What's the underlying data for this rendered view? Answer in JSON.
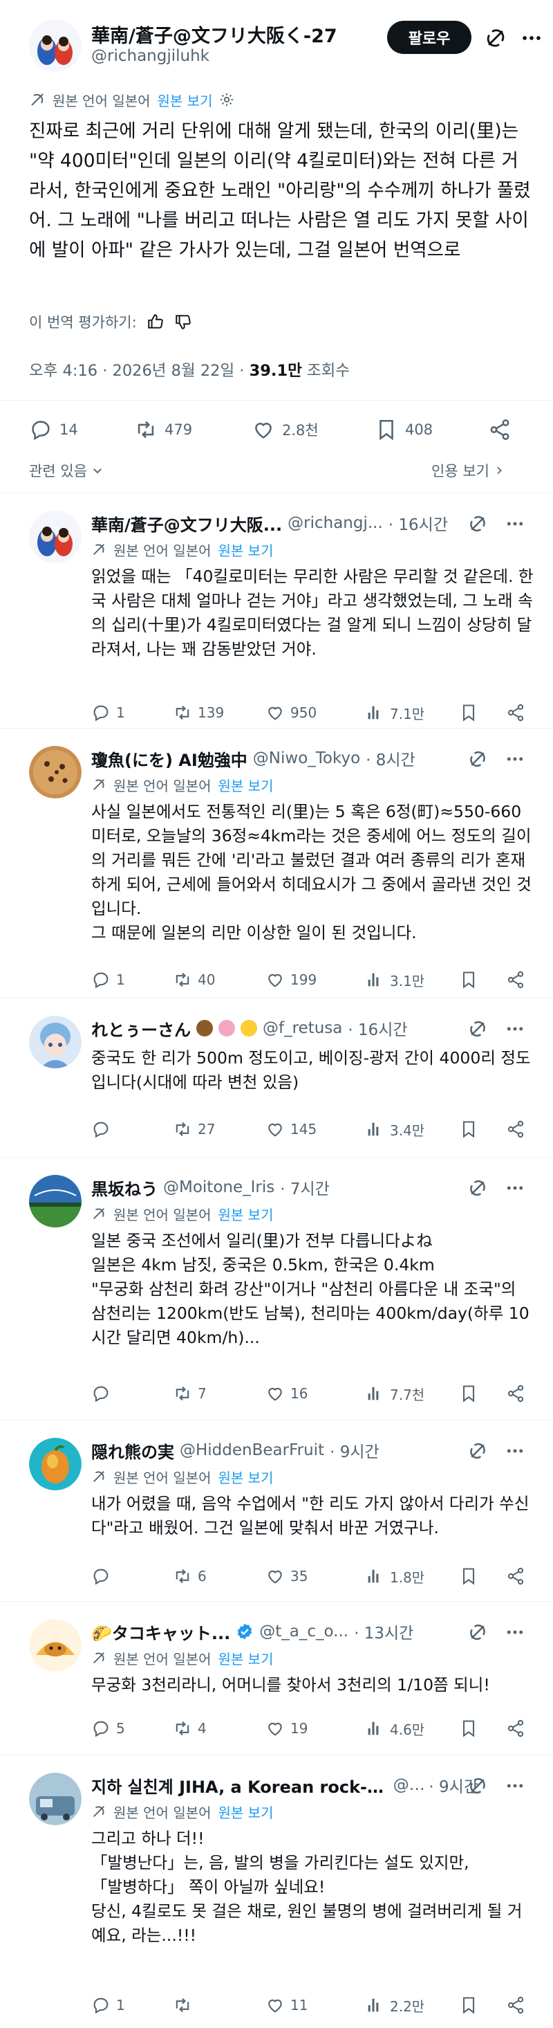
{
  "main_post": {
    "author_name": "華南/蒼子@文フリ大阪く-27",
    "author_handle": "@richangjiluhk",
    "follow_label": "팔로우",
    "translation_label": "원본 언어 일본어",
    "view_original_label": "원본 보기",
    "text": "진짜로 최근에 거리 단위에 대해 알게 됐는데, 한국의 이리(里)는 \"약 400미터\"인데 일본의 이리(약 4킬로미터)와는 전혀 다른 거라서, 한국인에게 중요한 노래인 \"아리랑\"의 수수께끼 하나가 풀렸어. 그 노래에 \"나를 버리고 떠나는 사람은 열 리도 가지 못할 사이에 발이 아파\" 같은 가사가 있는데, 그걸 일본어 번역으로",
    "rate_label": "이 번역 평가하기:",
    "time": "오후 4:16 · 2026년 8월 22일 · ",
    "views_count": "39.1만",
    "views_label": " 조회수",
    "replies_count": "14",
    "reposts_count": "479",
    "likes_count": "2.8천",
    "bookmarks_count": "408",
    "related_label": "관련 있음",
    "quotes_label": "인용 보기"
  },
  "replies": [
    {
      "name": "華南/蒼子@文フリ大阪...",
      "handle": "@richangj...",
      "time": "· 16시간",
      "translation_label": "원본 언어 일본어",
      "view_original_label": "원본 보기",
      "text": "읽었을 때는 「40킬로미터는 무리한 사람은 무리할 것 같은데. 한국 사람은 대체 얼마나 걷는 거야」라고 생각했었는데, 그 노래 속의 십리(十里)가 4킬로미터였다는 걸 알게 되니 느낌이 상당히 달라져서, 나는 꽤 감동받았던 거야.",
      "replies": "1",
      "reposts": "139",
      "likes": "950",
      "views": "7.1만"
    },
    {
      "name": "瓊魚(にを) AI勉強中",
      "handle": "@Niwo_Tokyo",
      "time": "· 8시간",
      "translation_label": "원본 언어 일본어",
      "view_original_label": "원본 보기",
      "text": "사실 일본에서도 전통적인 리(里)는 5 혹은 6정(町)≈550-660미터로, 오늘날의 36정≈4km라는 것은 중세에 어느 정도의 길이의 거리를 뭐든 간에 '리'라고 불렀던 결과 여러 종류의 리가 혼재하게 되어, 근세에 들어와서 히데요시가 그 중에서 골라낸 것인 것입니다.\n그 때문에 일본의 리만 이상한 일이 된 것입니다.",
      "replies": "1",
      "reposts": "40",
      "likes": "199",
      "views": "3.1만"
    },
    {
      "name": "れとぅーさん",
      "handle": "@f_retusa",
      "time": "· 16시간",
      "text": "중국도 한 리가 500m 정도이고, 베이징-광저 간이 4000리 정도입니다(시대에 따라 변천 있음)",
      "replies": "",
      "reposts": "27",
      "likes": "145",
      "views": "3.4만"
    },
    {
      "name": "黒坂ねう",
      "handle": "@Moitone_Iris",
      "time": "· 7시간",
      "translation_label": "원본 언어 일본어",
      "view_original_label": "원본 보기",
      "text": "일본 중국 조선에서 일리(里)가 전부 다릅니다よね\n일본은 4km 남짓, 중국은 0.5km, 한국은 0.4km\n\"무궁화 삼천리 화려 강산\"이거나 \"삼천리 아름다운 내 조국\"의 삼천리는 1200km(반도 남북), 천리마는 400km/day(하루 10시간 달리면 40km/h)...",
      "replies": "",
      "reposts": "7",
      "likes": "16",
      "views": "7.7천"
    },
    {
      "name": "隠れ熊の実",
      "handle": "@HiddenBearFruit",
      "time": "· 9시간",
      "translation_label": "원본 언어 일본어",
      "view_original_label": "원본 보기",
      "text": "내가 어렸을 때, 음악 수업에서 \"한 리도 가지 않아서 다리가 쑤신다\"라고 배웠어. 그건 일본에 맞춰서 바꾼 거였구나.",
      "replies": "",
      "reposts": "6",
      "likes": "35",
      "views": "1.8만"
    },
    {
      "name": "🌮タコキャット...",
      "handle": "@t_a_c_o...",
      "time": "· 13시간",
      "translation_label": "원본 언어 일본어",
      "view_original_label": "원본 보기",
      "text": "무궁화 3천리라니, 어머니를 찾아서 3천리의 1/10쯤 되니!",
      "replies": "5",
      "reposts": "4",
      "likes": "19",
      "views": "4.6만"
    },
    {
      "name": "지하 실친계 JIHA, a Korean rock-c...",
      "handle": "@...",
      "time": "· 9시간",
      "translation_label": "원본 언어 일본어",
      "view_original_label": "원본 보기",
      "text": "그리고 하나 더!!\n「발병난다」는, 음, 발의 병을 가리킨다는 설도 있지만,\n「발병하다」 쪽이 아닐까 싶네요!\n당신, 4킬로도 못 걸은 채로, 원인 불명의 병에 걸려버리게 될 거예요, 라는...!!!",
      "replies": "1",
      "reposts": "",
      "likes": "11",
      "views": "2.2만"
    }
  ],
  "colors": {
    "text": "#0f1419",
    "muted": "#536471",
    "link": "#1d9bf0",
    "divider": "#eff3f4"
  }
}
